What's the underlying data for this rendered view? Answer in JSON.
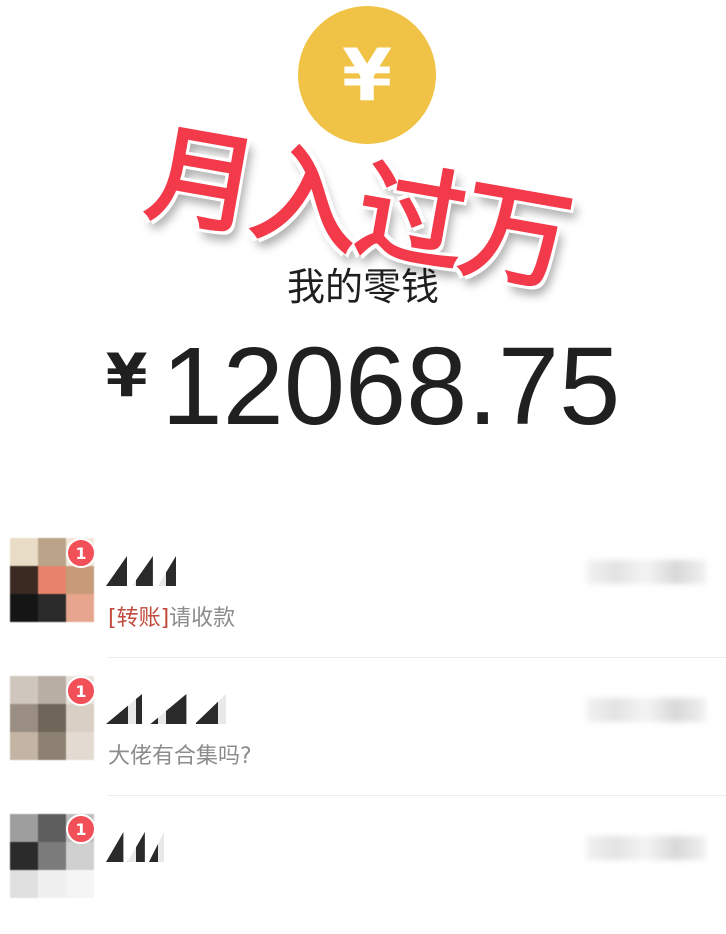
{
  "coin": {
    "symbol": "¥",
    "color": "#f0c346"
  },
  "overlay_text": "月入过万",
  "wallet": {
    "label": "我的零钱",
    "currency": "¥",
    "amount": "12068.75"
  },
  "chats": [
    {
      "badge": "1",
      "message_tag": "[转账]",
      "message_text": "请收款"
    },
    {
      "badge": "1",
      "message_tag": "",
      "message_text": "大佬有合集吗?"
    },
    {
      "badge": "1",
      "message_tag": "",
      "message_text": ""
    }
  ],
  "colors": {
    "badge": "#f25058",
    "overlay": "#f23a4a",
    "tag": "#c24a3c"
  }
}
